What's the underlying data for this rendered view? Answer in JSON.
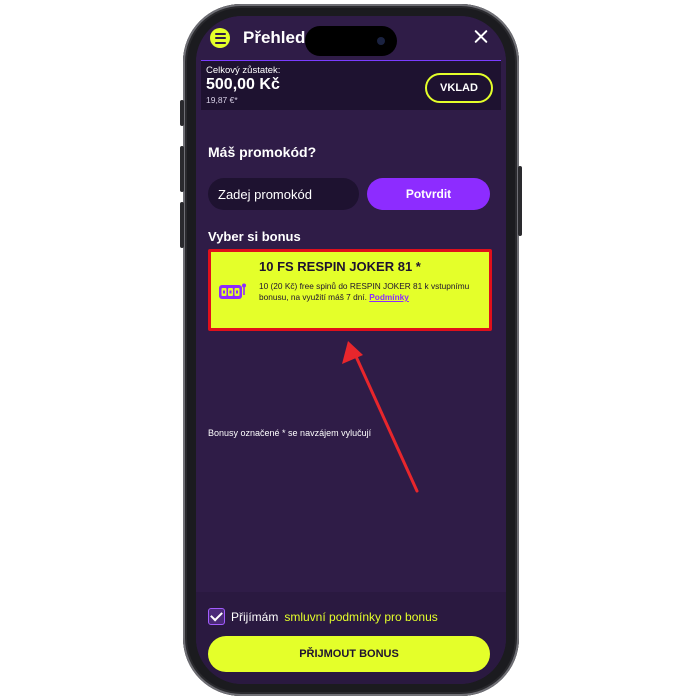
{
  "header": {
    "title": "Přehled",
    "menu_icon": "hamburger-icon",
    "close_icon": "close-icon"
  },
  "balance": {
    "label": "Celkový zůstatek:",
    "amount": "500,00 Kč",
    "eur": "19,87 €*",
    "deposit_label": "VKLAD"
  },
  "promo": {
    "title": "Máš promokód?",
    "placeholder": "Zadej promokód",
    "confirm_label": "Potvrdit"
  },
  "bonus": {
    "section_title": "Vyber si bonus",
    "name": "10 FS RESPIN JOKER 81 *",
    "description": "10 (20 Kč) free spinů do RESPIN JOKER 81 k vstupnímu bonusu, na využití máš 7 dní.",
    "terms_link": "Podmínky",
    "icon": "slot-machine-icon"
  },
  "footnote": "Bonusy označené * se navzájem vylučují",
  "terms": {
    "prefix": "Přijímám",
    "link": "smluvní podmínky pro bonus",
    "checked": true
  },
  "accept_label": "PŘIJMOUT BONUS",
  "colors": {
    "background": "#2f1c47",
    "accent": "#e4ff2a",
    "purple": "#8d2cff",
    "highlight": "#e0101b"
  }
}
